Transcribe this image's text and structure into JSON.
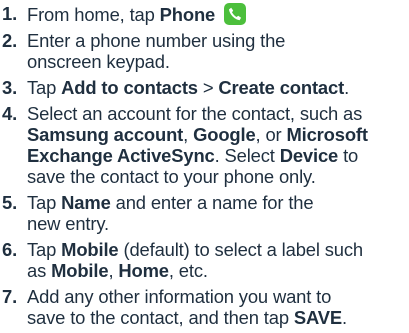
{
  "steps": [
    {
      "num": "1.",
      "parts": [
        {
          "t": "From home, tap "
        },
        {
          "b": "Phone"
        }
      ],
      "icon": "phone-app-icon"
    },
    {
      "num": "2.",
      "lines": [
        [
          {
            "t": "Enter a phone number using the"
          }
        ],
        [
          {
            "t": "onscreen keypad."
          }
        ]
      ]
    },
    {
      "num": "3.",
      "parts": [
        {
          "t": "Tap "
        },
        {
          "b": "Add to contacts"
        },
        {
          "t": " > "
        },
        {
          "b": "Create contact"
        },
        {
          "t": "."
        }
      ]
    },
    {
      "num": "4.",
      "lines": [
        [
          {
            "t": "Select an account for the contact, such as"
          }
        ],
        [
          {
            "b": "Samsung account"
          },
          {
            "t": ", "
          },
          {
            "b": "Google"
          },
          {
            "t": ", or "
          },
          {
            "b": "Microsoft"
          }
        ],
        [
          {
            "b": "Exchange ActiveSync"
          },
          {
            "t": ". Select "
          },
          {
            "b": "Device"
          },
          {
            "t": " to"
          }
        ],
        [
          {
            "t": "save the contact to your phone only."
          }
        ]
      ]
    },
    {
      "num": "5.",
      "lines": [
        [
          {
            "t": "Tap "
          },
          {
            "b": "Name"
          },
          {
            "t": " and enter a name for the"
          }
        ],
        [
          {
            "t": "new entry."
          }
        ]
      ]
    },
    {
      "num": "6.",
      "lines": [
        [
          {
            "t": "Tap "
          },
          {
            "b": "Mobile"
          },
          {
            "t": " (default) to select a label such"
          }
        ],
        [
          {
            "t": "as "
          },
          {
            "b": "Mobile"
          },
          {
            "t": ", "
          },
          {
            "b": "Home"
          },
          {
            "t": ", etc."
          }
        ]
      ]
    },
    {
      "num": "7.",
      "lines": [
        [
          {
            "t": "Add any other information you want to"
          }
        ],
        [
          {
            "t": "save to the contact, and then tap "
          },
          {
            "b": "SAVE"
          },
          {
            "t": "."
          }
        ]
      ]
    }
  ],
  "colors": {
    "text": "#1f2f3f",
    "phone_icon_bg": "#4cbf3c"
  }
}
